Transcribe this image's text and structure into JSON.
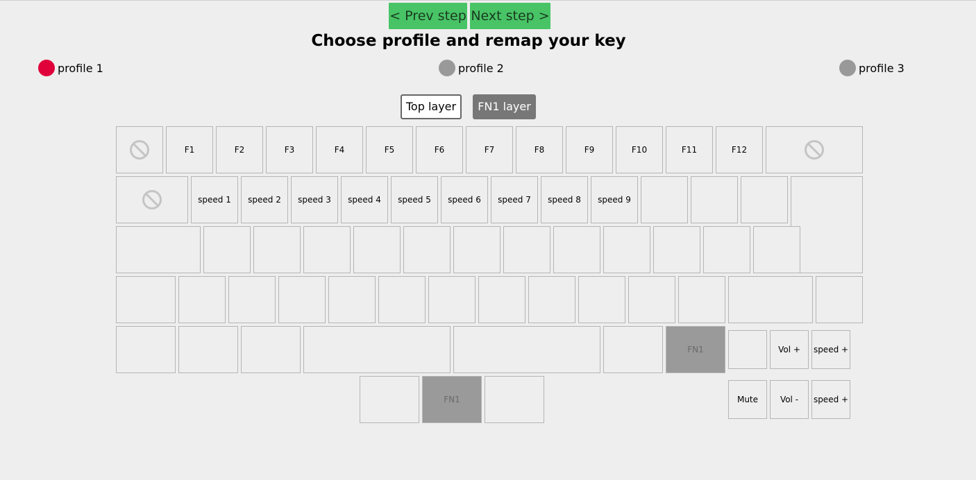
{
  "nav": {
    "prev_label": "< Prev step",
    "next_label": "Next step >"
  },
  "page_title": "Choose profile and remap your key",
  "profiles": [
    {
      "label": "profile 1",
      "selected": true
    },
    {
      "label": "profile 2",
      "selected": false
    },
    {
      "label": "profile 3",
      "selected": false
    }
  ],
  "colors": {
    "step_button": "#48c466",
    "selected_profile": "#e0003a",
    "unselected_profile": "#999999",
    "fn_key": "#9a9a9a"
  },
  "layers": {
    "top_label": "Top layer",
    "fn1_label": "FN1 layer",
    "active": "FN1 layer"
  },
  "keyboard": {
    "row1": [
      "",
      "F1",
      "F2",
      "F3",
      "F4",
      "F5",
      "F6",
      "F7",
      "F8",
      "F9",
      "F10",
      "F11",
      "F12",
      ""
    ],
    "row2": [
      "",
      "speed 1",
      "speed 2",
      "speed 3",
      "speed 4",
      "speed 5",
      "speed 6",
      "speed 7",
      "speed 8",
      "speed 9",
      "",
      "",
      "",
      ""
    ],
    "row3": [
      "",
      "",
      "",
      "",
      "",
      "",
      "",
      "",
      "",
      "",
      "",
      "",
      ""
    ],
    "row4": [
      "",
      "",
      "",
      "",
      "",
      "",
      "",
      "",
      "",
      "",
      "",
      "",
      ""
    ],
    "row5": [
      "",
      "",
      "",
      "",
      "",
      "",
      "FN1"
    ],
    "thumb": [
      "",
      "FN1",
      ""
    ],
    "side_top": [
      "",
      "Vol +",
      "speed +"
    ],
    "side_bottom": [
      "Mute",
      "Vol -",
      "speed +"
    ],
    "disabled_icon": "no-entry-icon"
  }
}
